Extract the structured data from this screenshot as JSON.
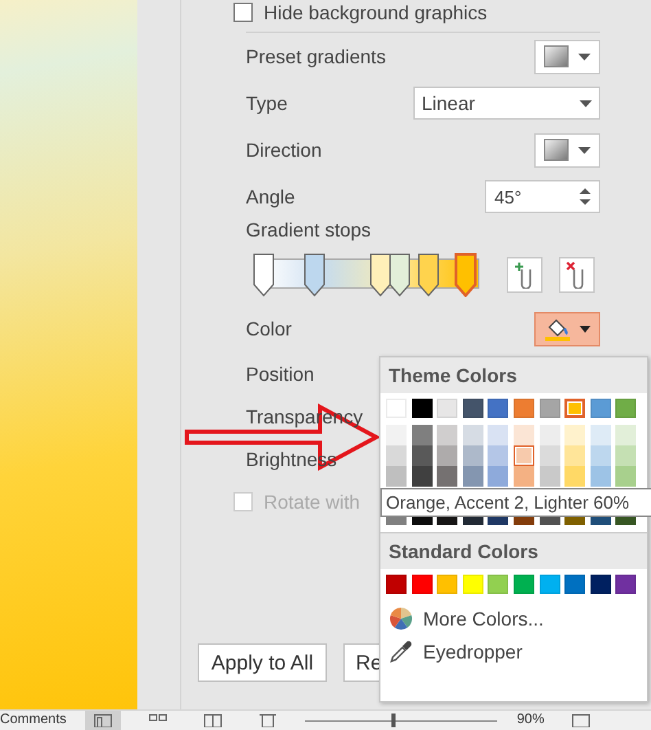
{
  "hide_background_graphics": {
    "label": "Hide background graphics",
    "checked": false
  },
  "fields": [
    {
      "kind": "swatch-dropdown",
      "label": "Preset gradients"
    },
    {
      "kind": "dropdown",
      "label": "Type",
      "value": "Linear"
    },
    {
      "kind": "swatch-dropdown",
      "label": "Direction"
    },
    {
      "kind": "spinner",
      "label": "Angle",
      "value": "45°"
    }
  ],
  "gradient_stops": {
    "label": "Gradient stops",
    "stops": [
      {
        "level": 0.02,
        "color": "#ffffff",
        "selected": false
      },
      {
        "level": 0.25,
        "color": "#bdd7ee",
        "selected": false
      },
      {
        "level": 0.55,
        "color": "#fff0b8",
        "selected": false
      },
      {
        "level": 0.64,
        "color": "#e2efd9",
        "selected": false
      },
      {
        "level": 0.77,
        "color": "#ffd34d",
        "selected": false
      },
      {
        "level": 0.94,
        "color": "#ffc000",
        "selected": true
      }
    ]
  },
  "color": {
    "label": "Color",
    "open": true,
    "color": "#ffc000"
  },
  "labels": [
    "Position",
    "Transparency",
    "Brightness"
  ],
  "rotate_with_shape": {
    "label": "Rotate with",
    "checked": false,
    "disabled": true
  },
  "buttons": [
    "Apply to All",
    "Re"
  ],
  "color_menu": {
    "theme_title": "Theme Colors",
    "theme_colors": [
      {
        "color": "#ffffff",
        "selected": false
      },
      {
        "color": "#000000",
        "selected": false
      },
      {
        "color": "#e7e6e6",
        "selected": false
      },
      {
        "color": "#44546a",
        "selected": false
      },
      {
        "color": "#4472c4",
        "selected": false
      },
      {
        "color": "#ed7d31",
        "selected": false
      },
      {
        "color": "#a5a5a5",
        "selected": false
      },
      {
        "color": "#ffc000",
        "selected": true
      },
      {
        "color": "#5b9bd5",
        "selected": false
      },
      {
        "color": "#70ad47",
        "selected": false
      }
    ],
    "shades": [
      [
        {
          "color": "#f2f2f2",
          "hovered": false
        },
        {
          "color": "#7f7f7f",
          "hovered": false
        },
        {
          "color": "#d0cece",
          "hovered": false
        },
        {
          "color": "#d6dce4",
          "hovered": false
        },
        {
          "color": "#d9e2f3",
          "hovered": false
        },
        {
          "color": "#fbe5d5",
          "hovered": false
        },
        {
          "color": "#ededed",
          "hovered": false
        },
        {
          "color": "#fff2cc",
          "hovered": false
        },
        {
          "color": "#deebf6",
          "hovered": false
        },
        {
          "color": "#e2efd9",
          "hovered": false
        }
      ],
      [
        {
          "color": "#d9d9d9",
          "hovered": false
        },
        {
          "color": "#595959",
          "hovered": false
        },
        {
          "color": "#aeabab",
          "hovered": false
        },
        {
          "color": "#adb9ca",
          "hovered": false
        },
        {
          "color": "#b4c6e7",
          "hovered": false
        },
        {
          "color": "#f7caac",
          "hovered": true
        },
        {
          "color": "#dbdbdb",
          "hovered": false
        },
        {
          "color": "#ffe599",
          "hovered": false
        },
        {
          "color": "#bdd7ee",
          "hovered": false
        },
        {
          "color": "#c5e0b3",
          "hovered": false
        }
      ],
      [
        {
          "color": "#bfbfbf",
          "hovered": false
        },
        {
          "color": "#404040",
          "hovered": false
        },
        {
          "color": "#757171",
          "hovered": false
        },
        {
          "color": "#8496b0",
          "hovered": false
        },
        {
          "color": "#8eaadb",
          "hovered": false
        },
        {
          "color": "#f4b183",
          "hovered": false
        },
        {
          "color": "#c9c9c9",
          "hovered": false
        },
        {
          "color": "#ffd966",
          "hovered": false
        },
        {
          "color": "#9dc3e6",
          "hovered": false
        },
        {
          "color": "#a8d08d",
          "hovered": false
        }
      ],
      [
        {
          "color": "#808080",
          "hovered": false
        },
        {
          "color": "#0d0d0d",
          "hovered": false
        },
        {
          "color": "#171616",
          "hovered": false
        },
        {
          "color": "#222a35",
          "hovered": false
        },
        {
          "color": "#1f3864",
          "hovered": false
        },
        {
          "color": "#833c0b",
          "hovered": false
        },
        {
          "color": "#525252",
          "hovered": false
        },
        {
          "color": "#7f6000",
          "hovered": false
        },
        {
          "color": "#1f4e79",
          "hovered": false
        },
        {
          "color": "#375623",
          "hovered": false
        }
      ]
    ],
    "tooltip": "Orange, Accent 2, Lighter 60%",
    "standard_title": "Standard Colors",
    "standard_colors": [
      {
        "color": "#c00000"
      },
      {
        "color": "#ff0000"
      },
      {
        "color": "#ffc000"
      },
      {
        "color": "#ffff00"
      },
      {
        "color": "#92d050"
      },
      {
        "color": "#00b050"
      },
      {
        "color": "#00b0f0"
      },
      {
        "color": "#0070c0"
      },
      {
        "color": "#002060"
      },
      {
        "color": "#7030a0"
      }
    ],
    "items": [
      {
        "kind": "more-colors",
        "label": "More Colors..."
      },
      {
        "kind": "eyedropper",
        "label": "Eyedropper"
      }
    ]
  },
  "status_bar": {
    "comments": "Comments",
    "zoom_slider": {
      "level": 0.45
    },
    "zoom": "90%"
  }
}
